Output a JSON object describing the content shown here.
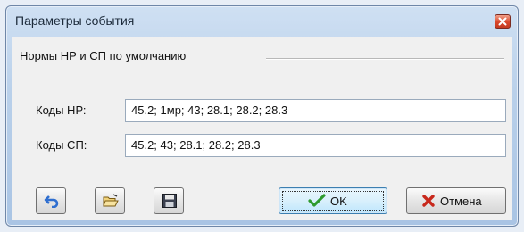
{
  "dialog": {
    "title": "Параметры события",
    "group_title": "Нормы НР и СП по умолчанию"
  },
  "fields": {
    "nr_label": "Коды НР:",
    "nr_value": "45.2; 1мр; 43; 28.1; 28.2; 28.3",
    "sp_label": "Коды СП:",
    "sp_value": "45.2; 43; 28.1; 28.2; 28.3"
  },
  "buttons": {
    "ok_label": "OK",
    "cancel_label": "Отмена",
    "icons": [
      "undo-icon",
      "open-folder-icon",
      "save-icon",
      "checkmark-icon",
      "cross-icon",
      "close-icon"
    ]
  },
  "colors": {
    "title_gradient": "#b9d0ea",
    "close_red": "#d9472b",
    "checkmark_green": "#2e9a2e",
    "cross_red": "#c8281c",
    "undo_blue": "#2f6fd0"
  }
}
